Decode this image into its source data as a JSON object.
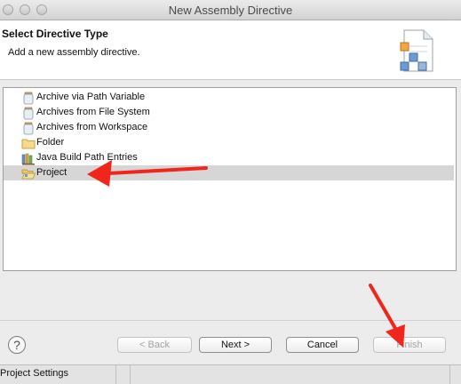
{
  "window": {
    "title": "New Assembly Directive"
  },
  "banner": {
    "title": "Select Directive Type",
    "description": "Add a new assembly directive.",
    "icon": "wizard-banner-icon"
  },
  "directive_types": [
    {
      "label": "Archive via Path Variable",
      "icon": "jar-icon",
      "selected": false
    },
    {
      "label": "Archives from File System",
      "icon": "jar-icon",
      "selected": false
    },
    {
      "label": "Archives from Workspace",
      "icon": "jar-icon",
      "selected": false
    },
    {
      "label": "Folder",
      "icon": "folder-icon",
      "selected": false
    },
    {
      "label": "Java Build Path Entries",
      "icon": "library-icon",
      "selected": false
    },
    {
      "label": "Project",
      "icon": "open-folder-icon",
      "selected": true
    }
  ],
  "buttons": {
    "help": "?",
    "back": "< Back",
    "next": "Next >",
    "cancel": "Cancel",
    "finish": "Finish"
  },
  "background": {
    "label": "Project Settings"
  },
  "colors": {
    "annotation_arrow": "#f0251c",
    "selection": "#d6d6d6"
  }
}
